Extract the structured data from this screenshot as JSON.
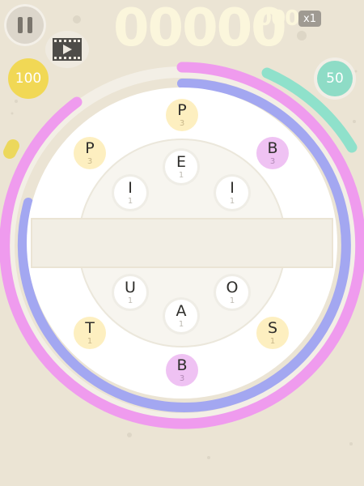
{
  "hud": {
    "score_main": "00000",
    "score_sub": "000",
    "multiplier": "x1",
    "bonus_left": "100",
    "bonus_right": "50"
  },
  "colors": {
    "background": "#ebe4d4",
    "ring_pink": "#ef9bee",
    "ring_blue": "#a3a7f1",
    "ring_teal": "#8fe1cb",
    "ring_yellow": "#ecd85c",
    "board": "#ffffff",
    "tile_yellow": "#fdefc0",
    "tile_pink": "#efc2f3"
  },
  "icons": {
    "pause": "pause-icon",
    "video": "film-play-icon"
  },
  "tiles": {
    "inner": [
      {
        "letter": "E",
        "points": "1"
      },
      {
        "letter": "I",
        "points": "1"
      },
      {
        "letter": "I",
        "points": "1"
      },
      {
        "letter": "U",
        "points": "1"
      },
      {
        "letter": "O",
        "points": "1"
      },
      {
        "letter": "A",
        "points": "1"
      }
    ],
    "outer": [
      {
        "letter": "P",
        "points": "3"
      },
      {
        "letter": "P",
        "points": "3"
      },
      {
        "letter": "B",
        "points": "3"
      },
      {
        "letter": "T",
        "points": "1"
      },
      {
        "letter": "S",
        "points": "1"
      },
      {
        "letter": "B",
        "points": "3"
      }
    ]
  },
  "word_bar": {
    "text": ""
  }
}
